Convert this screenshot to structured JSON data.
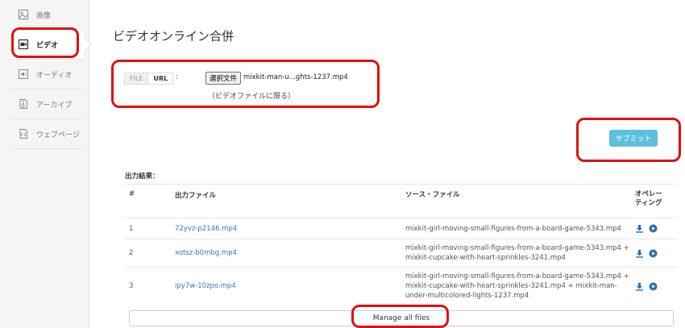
{
  "sidebar": {
    "items": [
      {
        "label": "画像",
        "icon": "image-icon"
      },
      {
        "label": "ビデオ",
        "icon": "video-icon",
        "active": true
      },
      {
        "label": "オーディオ",
        "icon": "audio-icon"
      },
      {
        "label": "アーカイブ",
        "icon": "archive-icon"
      },
      {
        "label": "ウェブページ",
        "icon": "webpage-icon"
      }
    ]
  },
  "main": {
    "title": "ビデオオンライン合併",
    "tabs": {
      "file": "FILE",
      "url": "URL"
    },
    "colon": ":",
    "file_button": "選択文件",
    "file_name": "mixkit-man-u...ghts-1237.mp4",
    "file_note": "（ビデオファイルに限る）",
    "submit": "サブミット"
  },
  "results": {
    "title": "出力結果：",
    "headers": {
      "num": "#",
      "output": "出力ファイル",
      "source": "ソース・ファイル",
      "ops_line1": "オペレー",
      "ops_line2": "ティング"
    },
    "rows": [
      {
        "num": "1",
        "output": "72yvz-p2146.mp4",
        "src1": "mixkit-girl-moving-small-figures-from-a-board-game-5343.mp4",
        "src2": "",
        "src3": ""
      },
      {
        "num": "2",
        "output": "xotsz-b0mbg.mp4",
        "src1": "mixkit-girl-moving-small-figures-from-a-board-game-5343.mp4 +",
        "src2": "mixkit-cupcake-with-heart-sprinkles-3241.mp4",
        "src3": ""
      },
      {
        "num": "3",
        "output": "ipy7w-10zpo.mp4",
        "src1": "mixkit-girl-moving-small-figures-from-a-board-game-5343.mp4 +",
        "src2": "mixkit-cupcake-with-heart-sprinkles-3241.mp4 + mixkit-man-",
        "src3": "under-multicolored-lights-1237.mp4"
      }
    ],
    "manage": "Manage all files"
  },
  "colors": {
    "accent": "#5bc0de",
    "link": "#337ab7",
    "highlight": "#e01010"
  }
}
